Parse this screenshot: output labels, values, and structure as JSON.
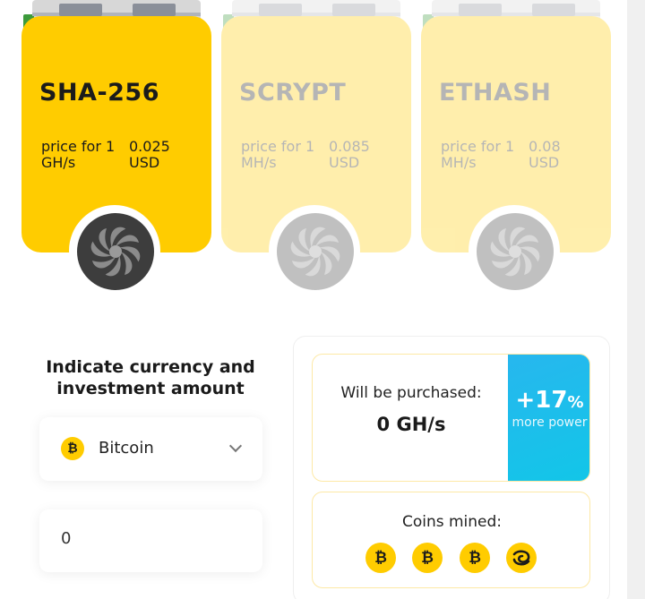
{
  "algorithms": [
    {
      "name": "SHA-256",
      "price_label": "price for 1 GH/s",
      "price_value": "0.025 USD",
      "active": true
    },
    {
      "name": "SCRYPT",
      "price_label": "price for 1 MH/s",
      "price_value": "0.085 USD",
      "active": false
    },
    {
      "name": "ETHASH",
      "price_label": "price for 1 MH/s",
      "price_value": "0.08 USD",
      "active": false
    }
  ],
  "form": {
    "title": "Indicate currency and investment amount",
    "currency": {
      "selected": "Bitcoin",
      "icon": "bitcoin-icon",
      "glyph": "₿"
    },
    "amount": {
      "value": "0"
    }
  },
  "result": {
    "purchase_label": "Will be purchased:",
    "purchase_value": "0 GH/s",
    "bonus_value": "+17",
    "bonus_unit": "%",
    "bonus_text": "more power",
    "mined_label": "Coins mined:",
    "coins": [
      {
        "icon": "bitcoin-icon",
        "glyph": "₿"
      },
      {
        "icon": "bitcoin-icon",
        "glyph": "₿"
      },
      {
        "icon": "bitcoin-icon",
        "glyph": "₿"
      },
      {
        "icon": "spiral-coin-icon",
        "glyph": "@"
      }
    ]
  },
  "colors": {
    "accent": "#ffcc00",
    "bonus": "#1fbdee",
    "fan_active": "#3d3d3d"
  }
}
